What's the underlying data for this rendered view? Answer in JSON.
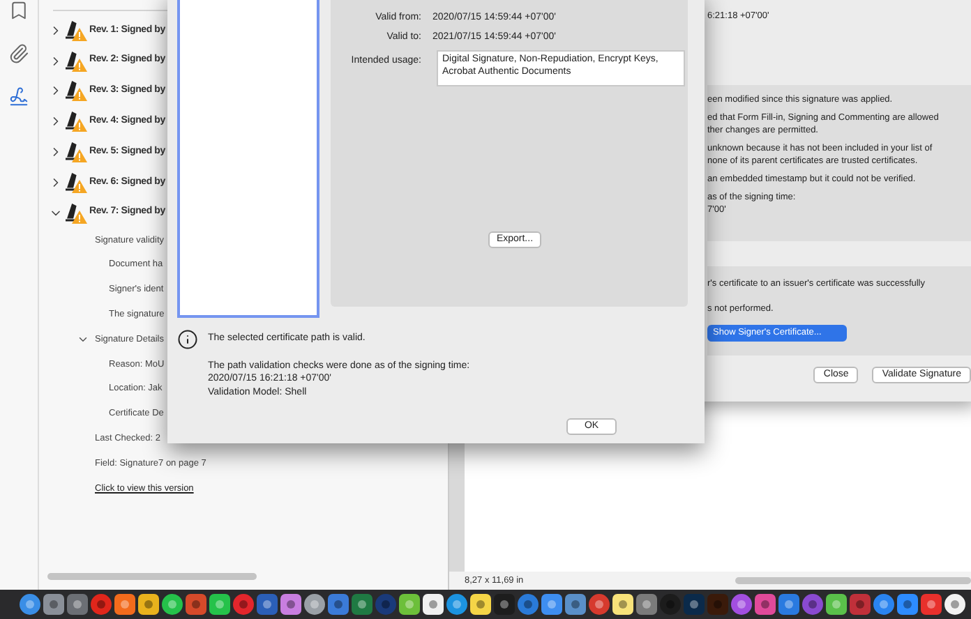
{
  "rail": {
    "items": [
      {
        "kind": "bookmark",
        "selected": false
      },
      {
        "kind": "attachment",
        "selected": false
      },
      {
        "kind": "signature",
        "selected": true
      }
    ]
  },
  "signatures_panel": {
    "revisions": [
      {
        "label": "Rev. 1: Signed by",
        "expanded": false
      },
      {
        "label": "Rev. 2: Signed by",
        "expanded": false
      },
      {
        "label": "Rev. 3: Signed by",
        "expanded": false
      },
      {
        "label": "Rev. 4: Signed by",
        "expanded": false
      },
      {
        "label": "Rev. 5: Signed by",
        "expanded": false
      },
      {
        "label": "Rev. 6: Signed by",
        "expanded": false
      },
      {
        "label": "Rev. 7: Signed by",
        "expanded": true,
        "children": [
          {
            "kind": "node",
            "label": "Signature validity",
            "children": [
              {
                "kind": "node",
                "label": "Document ha"
              },
              {
                "kind": "node",
                "label": "Signer's ident"
              },
              {
                "kind": "node",
                "label": "The signature"
              }
            ]
          },
          {
            "kind": "node",
            "label": "Signature Details",
            "expanded": true,
            "children": [
              {
                "kind": "node",
                "label": "Reason: MoU"
              },
              {
                "kind": "node",
                "label": "Location: Jak"
              },
              {
                "kind": "node",
                "label": "Certificate De"
              }
            ]
          },
          {
            "kind": "node",
            "label": "Last Checked: 2"
          },
          {
            "kind": "node",
            "label": "Field: Signature7 on page 7"
          },
          {
            "kind": "link",
            "label": "Click to view this version"
          }
        ]
      }
    ]
  },
  "certificate_dialog": {
    "details": [
      {
        "label": "Valid from:",
        "value": "2020/07/15 14:59:44 +07'00'"
      },
      {
        "label": "Valid to:",
        "value": "2021/07/15 14:59:44 +07'00'"
      }
    ],
    "intended_usage": {
      "label": "Intended usage:",
      "value": "Digital Signature, Non-Repudiation, Encrypt Keys, Acrobat Authentic Documents"
    },
    "export_button": "Export...",
    "status": "The selected certificate path is valid.",
    "validation_note": [
      "The path validation checks were done as of the signing time:",
      "2020/07/15 16:21:18 +07'00'",
      "Validation Model: Shell"
    ],
    "ok_button": "OK"
  },
  "signature_properties": {
    "top_lines": [
      "6:21:18 +07'00'"
    ],
    "validity_lines": [
      [
        "een modified since this signature was applied."
      ],
      [
        "ed that Form Fill-in, Signing and Commenting are allowed",
        "ther changes are permitted."
      ],
      [
        "unknown because it has not been included in your list of",
        "none of its parent certificates are trusted certificates."
      ],
      [
        "an embedded timestamp but it could not be verified."
      ],
      [
        "as of the signing time:",
        "7'00'"
      ]
    ],
    "path_lines": [
      "r's certificate to an issuer's certificate was successfully",
      "s not performed."
    ],
    "show_certificate_button": "Show Signer's Certificate...",
    "buttons": [
      "Close",
      "Validate Signature"
    ]
  },
  "status_bar": {
    "page_size": "8,27 x 11,69 in"
  }
}
